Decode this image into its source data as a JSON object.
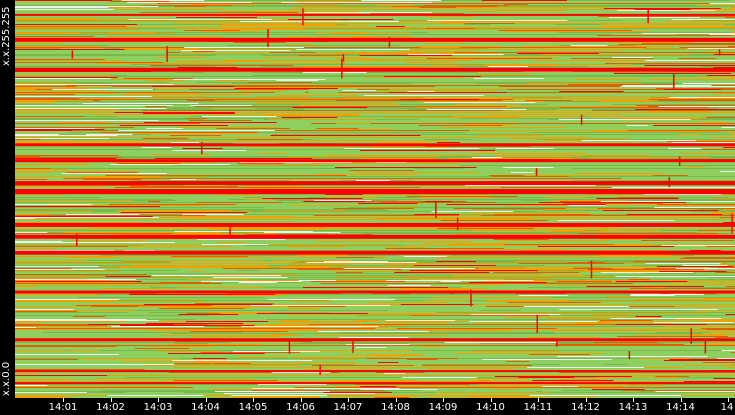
{
  "chart_data": {
    "type": "heatmap",
    "y_axis": {
      "top_label": "x.x.255.255",
      "bottom_label": "x.x.0.0"
    },
    "x_axis": {
      "tick_labels": [
        "14:01",
        "14:02",
        "14:03",
        "14:04",
        "14:05",
        "14:06",
        "14:07",
        "14:08",
        "14:09",
        "14:10",
        "14:11",
        "14:12",
        "14:13",
        "14:14",
        "14"
      ]
    },
    "colors": {
      "light_green": "#8ed060",
      "green": "#79b84a",
      "orange": "#f0a000",
      "dark_orange": "#e06000",
      "red": "#ff0000",
      "white_speckle": "#f0f0f0"
    },
    "heavy_red_bands": [
      {
        "y_fraction": 0.035
      },
      {
        "y_fraction": 0.095
      },
      {
        "y_fraction": 0.17
      },
      {
        "y_fraction": 0.36
      },
      {
        "y_fraction": 0.4
      },
      {
        "y_fraction": 0.455
      },
      {
        "y_fraction": 0.475
      },
      {
        "y_fraction": 0.56
      },
      {
        "y_fraction": 0.59
      },
      {
        "y_fraction": 0.63
      },
      {
        "y_fraction": 0.73
      },
      {
        "y_fraction": 0.85
      },
      {
        "y_fraction": 0.93
      },
      {
        "y_fraction": 0.96
      }
    ]
  }
}
